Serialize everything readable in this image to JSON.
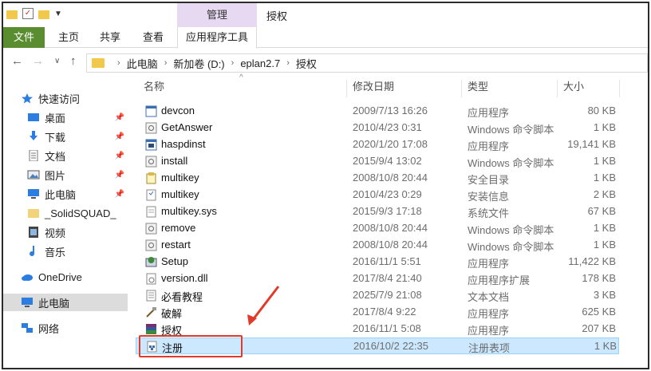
{
  "window": {
    "title": "授权",
    "context_group": "管理"
  },
  "ribbon": {
    "tabs": [
      "文件",
      "主页",
      "共享",
      "查看",
      "应用程序工具"
    ]
  },
  "address": {
    "crumbs": [
      "此电脑",
      "新加卷 (D:)",
      "eplan2.7",
      "授权"
    ]
  },
  "nav": {
    "items": [
      {
        "label": "快速访问",
        "icon": "star-icon"
      },
      {
        "label": "桌面",
        "icon": "desktop-icon"
      },
      {
        "label": "下载",
        "icon": "download-icon"
      },
      {
        "label": "文档",
        "icon": "document-icon"
      },
      {
        "label": "图片",
        "icon": "pictures-icon"
      },
      {
        "label": "此电脑",
        "icon": "computer-icon"
      },
      {
        "label": "_SolidSQUAD_",
        "icon": "folder-icon"
      },
      {
        "label": "视频",
        "icon": "video-icon"
      },
      {
        "label": "音乐",
        "icon": "music-icon"
      },
      {
        "label": "OneDrive",
        "icon": "cloud-icon"
      },
      {
        "label": "此电脑",
        "icon": "computer-icon"
      },
      {
        "label": "网络",
        "icon": "network-icon"
      }
    ]
  },
  "columns": {
    "name": "名称",
    "date": "修改日期",
    "type": "类型",
    "size": "大小"
  },
  "files": [
    {
      "name": "devcon",
      "date": "2009/7/13 16:26",
      "type": "应用程序",
      "size": "80 KB",
      "icon": "exe-icon"
    },
    {
      "name": "GetAnswer",
      "date": "2010/4/23 0:31",
      "type": "Windows 命令脚本",
      "size": "1 KB",
      "icon": "script-icon"
    },
    {
      "name": "haspdinst",
      "date": "2020/1/20 17:08",
      "type": "应用程序",
      "size": "19,141 KB",
      "icon": "exe-icon"
    },
    {
      "name": "install",
      "date": "2015/9/4 13:02",
      "type": "Windows 命令脚本",
      "size": "1 KB",
      "icon": "script-icon"
    },
    {
      "name": "multikey",
      "date": "2008/10/8 20:44",
      "type": "安全目录",
      "size": "1 KB",
      "icon": "catalog-icon"
    },
    {
      "name": "multikey",
      "date": "2010/4/23 0:29",
      "type": "安装信息",
      "size": "2 KB",
      "icon": "inf-icon"
    },
    {
      "name": "multikey.sys",
      "date": "2015/9/3 17:18",
      "type": "系统文件",
      "size": "67 KB",
      "icon": "sys-icon"
    },
    {
      "name": "remove",
      "date": "2008/10/8 20:44",
      "type": "Windows 命令脚本",
      "size": "1 KB",
      "icon": "script-icon"
    },
    {
      "name": "restart",
      "date": "2008/10/8 20:44",
      "type": "Windows 命令脚本",
      "size": "1 KB",
      "icon": "script-icon"
    },
    {
      "name": "Setup",
      "date": "2016/11/1 5:51",
      "type": "应用程序",
      "size": "11,422 KB",
      "icon": "setup-icon"
    },
    {
      "name": "version.dll",
      "date": "2017/8/4 21:40",
      "type": "应用程序扩展",
      "size": "178 KB",
      "icon": "dll-icon"
    },
    {
      "name": "必看教程",
      "date": "2025/7/9 21:08",
      "type": "文本文档",
      "size": "3 KB",
      "icon": "text-icon"
    },
    {
      "name": "破解",
      "date": "2017/8/4 9:22",
      "type": "应用程序",
      "size": "625 KB",
      "icon": "crack-exe-icon"
    },
    {
      "name": "授权",
      "date": "2016/11/1 5:08",
      "type": "应用程序",
      "size": "207 KB",
      "icon": "archive-exe-icon"
    },
    {
      "name": "注册",
      "date": "2016/10/2 22:35",
      "type": "注册表项",
      "size": "1 KB",
      "icon": "registry-icon"
    }
  ]
}
